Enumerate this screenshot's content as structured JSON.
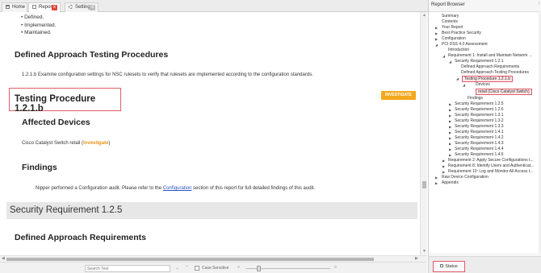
{
  "tabs": [
    {
      "label": "Home"
    },
    {
      "label": "Report",
      "close": "x"
    },
    {
      "label": "Settings",
      "close": "x"
    }
  ],
  "report": {
    "bullets": [
      "Defined.",
      "Implemented.",
      "Maintained."
    ],
    "h_approach_testing": "Defined Approach Testing Procedures",
    "procedure_text": "1.2.1.b Examine configuration settings for NSC rulesets to verify that rulesets are implemented according to the configuration standards.",
    "testing_procedure_title": "Testing Procedure 1.2.1.b",
    "investigate_button": "INVESTIGATE",
    "h_affected_devices": "Affected Devices",
    "device_text": "Cisco Catalyst Switch retail (",
    "device_link": "Investigate",
    "device_text_end": ")",
    "h_findings": "Findings",
    "findings_text_1": "Nipper performed a Configuration audit. Please refer to the",
    "findings_link": "Configuration",
    "findings_text_2": "section of this report for full detailed findings of this audit.",
    "section_heading": "Security Requirement 1.2.5",
    "h_approach_requirements": "Defined Approach Requirements"
  },
  "searchbar": {
    "placeholder": "Search Text",
    "case_sensitive": "Case Sensitive"
  },
  "report_browser": {
    "title": "Report Browser",
    "status_button": "Status",
    "tree": [
      {
        "label": "Summary"
      },
      {
        "label": "Contents"
      },
      {
        "label": "Your Report"
      },
      {
        "label": "Best Practice Security"
      },
      {
        "label": "Configuration"
      },
      {
        "label": "PCI DSS 4.0 Assessment"
      },
      {
        "label": "Introduction"
      },
      {
        "label": "Requirement 1: Install and Maintain Network ..."
      },
      {
        "label": "Security Requirement 1.2.1"
      },
      {
        "label": "Defined Approach Requirements"
      },
      {
        "label": "Defined Approach Testing Procedures"
      },
      {
        "label": "Testing Procedure 1.2.1.b"
      },
      {
        "label": "Devices"
      },
      {
        "label": "retail (Cisco Catalyst Switch)"
      },
      {
        "label": "Findings"
      },
      {
        "label": "Security Requirement 1.2.5"
      },
      {
        "label": "Security Requirement 1.2.6"
      },
      {
        "label": "Security Requirement 1.3.1"
      },
      {
        "label": "Security Requirement 1.3.2"
      },
      {
        "label": "Security Requirement 1.3.3"
      },
      {
        "label": "Security Requirement 1.4.1"
      },
      {
        "label": "Security Requirement 1.4.2"
      },
      {
        "label": "Security Requirement 1.4.3"
      },
      {
        "label": "Security Requirement 1.4.4"
      },
      {
        "label": "Security Requirement 1.4.5"
      },
      {
        "label": "Requirement 2: Apply Secure Configurations t..."
      },
      {
        "label": "Requirement 8: Identify Users and Authenticat..."
      },
      {
        "label": "Requirement 10: Log and Monitor All Access t..."
      },
      {
        "label": "Raw Device Configuration"
      },
      {
        "label": "Appendix"
      }
    ]
  },
  "colors": {
    "investigate": "#f4a81c",
    "highlight_border": "#e05c6a",
    "link_blue": "#2a55c2"
  }
}
